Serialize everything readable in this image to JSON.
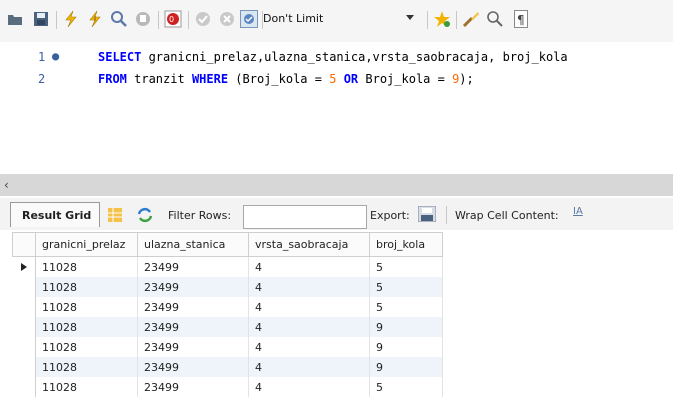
{
  "toolbar": {
    "limit_label": "Don't Limit",
    "icons": [
      "folder-icon",
      "save-icon",
      "execute-icon",
      "execute-selection-icon",
      "explain-icon",
      "stop-icon",
      "stop-on-error-icon",
      "commit-icon",
      "rollback-icon",
      "autocommit-icon",
      "limit-dropdown",
      "beautify-icon",
      "magnifier-icon",
      "invisible-chars-icon"
    ]
  },
  "editor": {
    "lines": [
      {
        "num": "1",
        "marker": "●",
        "parts": [
          {
            "t": "SELECT",
            "c": "kw"
          },
          {
            "t": " granicni_prelaz,ulazna_stanica,vrsta_saobracaja, broj_kola",
            "c": ""
          }
        ]
      },
      {
        "num": "2",
        "marker": "",
        "parts": [
          {
            "t": "FROM",
            "c": "kw"
          },
          {
            "t": " tranzit ",
            "c": ""
          },
          {
            "t": "WHERE",
            "c": "kw"
          },
          {
            "t": " (Broj_kola = ",
            "c": ""
          },
          {
            "t": "5",
            "c": "num"
          },
          {
            "t": " ",
            "c": ""
          },
          {
            "t": "OR",
            "c": "kw"
          },
          {
            "t": " Broj_kola = ",
            "c": ""
          },
          {
            "t": "9",
            "c": "num"
          },
          {
            "t": ");",
            "c": ""
          }
        ]
      }
    ]
  },
  "resultbar": {
    "result_grid": "Result Grid",
    "filter_rows": "Filter Rows:",
    "filter_value": "",
    "export": "Export:",
    "wrap": "Wrap Cell Content:",
    "wrap_icon": "IA"
  },
  "grid": {
    "columns": [
      "granicni_prelaz",
      "ulazna_stanica",
      "vrsta_saobracaja",
      "broj_kola"
    ],
    "rows": [
      [
        "11028",
        "23499",
        "4",
        "5"
      ],
      [
        "11028",
        "23499",
        "4",
        "5"
      ],
      [
        "11028",
        "23499",
        "4",
        "5"
      ],
      [
        "11028",
        "23499",
        "4",
        "9"
      ],
      [
        "11028",
        "23499",
        "4",
        "9"
      ],
      [
        "11028",
        "23499",
        "4",
        "9"
      ],
      [
        "11028",
        "23499",
        "4",
        "5"
      ]
    ]
  }
}
